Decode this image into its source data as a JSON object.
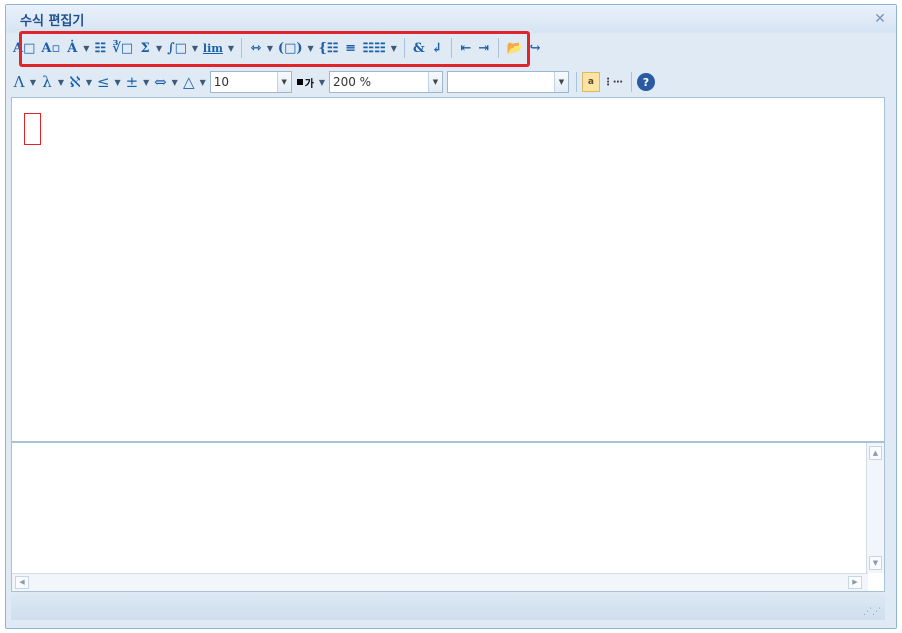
{
  "window": {
    "title": "수식 편집기"
  },
  "toolbar1": [
    {
      "name": "superscript-button",
      "glyph": "A□",
      "drop": false
    },
    {
      "name": "subscript-button",
      "glyph": "A▫",
      "drop": false
    },
    {
      "name": "accent-button",
      "glyph": "Ȧ",
      "drop": true
    },
    {
      "name": "fraction-button",
      "glyph": "☷",
      "drop": false
    },
    {
      "name": "root-button",
      "glyph": "∛□",
      "drop": false
    },
    {
      "name": "sum-button",
      "glyph": "Σ",
      "drop": true
    },
    {
      "name": "integral-button",
      "glyph": "∫□",
      "drop": true
    },
    {
      "name": "limit-button",
      "glyph": "lim",
      "drop": true
    },
    {
      "name": "arrow-stack-button",
      "glyph": "⇿",
      "drop": true
    },
    {
      "name": "bracket-button",
      "glyph": "(□)",
      "drop": true
    },
    {
      "name": "cases-button",
      "glyph": "{☷",
      "drop": false
    },
    {
      "name": "align-button",
      "glyph": "≡",
      "drop": false
    },
    {
      "name": "matrix-button",
      "glyph": "☷☷",
      "drop": true
    },
    {
      "name": "ampersand-button",
      "glyph": "&",
      "drop": false
    },
    {
      "name": "newline-button",
      "glyph": "↲",
      "drop": false
    },
    {
      "name": "move-left-button",
      "glyph": "⇤",
      "drop": false
    },
    {
      "name": "move-right-button",
      "glyph": "⇥",
      "drop": false
    },
    {
      "name": "open-folder-button",
      "glyph": "📂",
      "drop": false
    },
    {
      "name": "export-button",
      "glyph": "↪",
      "drop": false
    }
  ],
  "toolbar2_symbols": [
    {
      "name": "greek-upper-button",
      "glyph": "Λ"
    },
    {
      "name": "greek-lower-button",
      "glyph": "λ"
    },
    {
      "name": "hebrew-button",
      "glyph": "ℵ"
    },
    {
      "name": "relation-button",
      "glyph": "≤"
    },
    {
      "name": "operator-button",
      "glyph": "±"
    },
    {
      "name": "arrow-button",
      "glyph": "⇔"
    },
    {
      "name": "misc-symbol-button",
      "glyph": "△"
    }
  ],
  "font_size": {
    "value": "10"
  },
  "color_label": "가",
  "zoom": {
    "value": "200 %"
  },
  "font_name": {
    "value": ""
  },
  "toggle_label": "a",
  "help_glyph": "?"
}
